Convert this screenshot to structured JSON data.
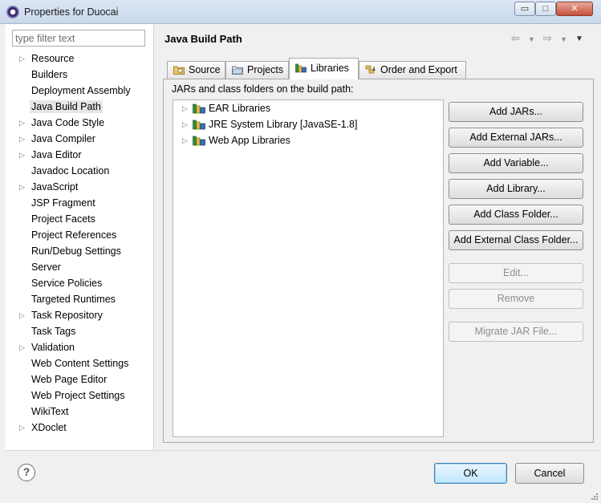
{
  "window": {
    "title": "Properties for Duocai",
    "minimize_glyph": "▭",
    "maximize_glyph": "□",
    "close_glyph": "✕"
  },
  "filter": {
    "placeholder": "type filter text",
    "value": ""
  },
  "nav_tree": [
    {
      "label": "Resource",
      "expandable": true
    },
    {
      "label": "Builders",
      "expandable": false
    },
    {
      "label": "Deployment Assembly",
      "expandable": false
    },
    {
      "label": "Java Build Path",
      "expandable": false,
      "selected": true
    },
    {
      "label": "Java Code Style",
      "expandable": true
    },
    {
      "label": "Java Compiler",
      "expandable": true
    },
    {
      "label": "Java Editor",
      "expandable": true
    },
    {
      "label": "Javadoc Location",
      "expandable": false
    },
    {
      "label": "JavaScript",
      "expandable": true
    },
    {
      "label": "JSP Fragment",
      "expandable": false
    },
    {
      "label": "Project Facets",
      "expandable": false
    },
    {
      "label": "Project References",
      "expandable": false
    },
    {
      "label": "Run/Debug Settings",
      "expandable": false
    },
    {
      "label": "Server",
      "expandable": false
    },
    {
      "label": "Service Policies",
      "expandable": false
    },
    {
      "label": "Targeted Runtimes",
      "expandable": false
    },
    {
      "label": "Task Repository",
      "expandable": true
    },
    {
      "label": "Task Tags",
      "expandable": false
    },
    {
      "label": "Validation",
      "expandable": true
    },
    {
      "label": "Web Content Settings",
      "expandable": false
    },
    {
      "label": "Web Page Editor",
      "expandable": false
    },
    {
      "label": "Web Project Settings",
      "expandable": false
    },
    {
      "label": "WikiText",
      "expandable": false
    },
    {
      "label": "XDoclet",
      "expandable": true
    }
  ],
  "page": {
    "title": "Java Build Path",
    "nav_back_glyph": "⇦",
    "nav_fwd_glyph": "⇨",
    "menu_glyph": "▼"
  },
  "tabs": [
    {
      "label": "Source",
      "icon": "source-folder-icon"
    },
    {
      "label": "Projects",
      "icon": "project-folder-icon"
    },
    {
      "label": "Libraries",
      "icon": "library-icon",
      "active": true
    },
    {
      "label": "Order and Export",
      "icon": "order-export-icon"
    }
  ],
  "libraries": {
    "description": "JARs and class folders on the build path:",
    "items": [
      {
        "label": "EAR Libraries"
      },
      {
        "label": "JRE System Library [JavaSE-1.8]"
      },
      {
        "label": "Web App Libraries"
      }
    ]
  },
  "buttons": {
    "add_jars": "Add JARs...",
    "add_external_jars": "Add External JARs...",
    "add_variable": "Add Variable...",
    "add_library": "Add Library...",
    "add_class_folder": "Add Class Folder...",
    "add_external_class_folder": "Add External Class Folder...",
    "edit": "Edit...",
    "remove": "Remove",
    "migrate_jar": "Migrate JAR File..."
  },
  "footer": {
    "help_glyph": "?",
    "ok": "OK",
    "cancel": "Cancel"
  },
  "colors": {
    "ok_border": "#3c7fb1",
    "library_icon_green": "#3a8c3a",
    "library_icon_yellow": "#e5c24a"
  }
}
